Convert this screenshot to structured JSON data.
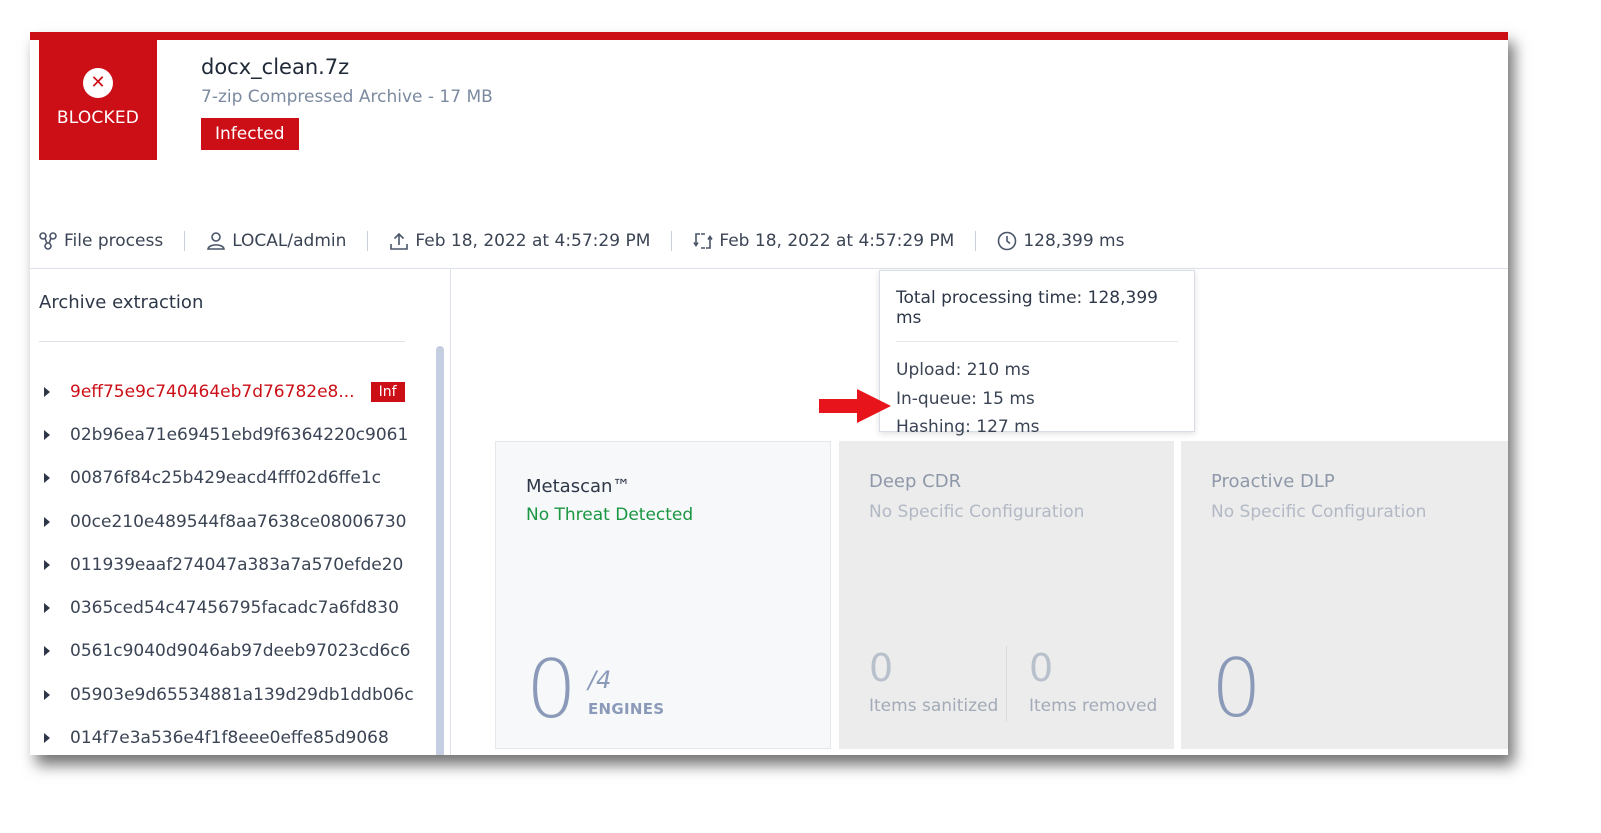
{
  "verdict": {
    "label": "BLOCKED",
    "icon": "close-circle-icon"
  },
  "file": {
    "name": "docx_clean.7z",
    "subtitle": "7-zip Compressed Archive - 17 MB",
    "status_badge": "Infected"
  },
  "meta": {
    "workflow": {
      "icon": "workflow-icon",
      "label": "File process"
    },
    "user": {
      "icon": "user-icon",
      "label": "LOCAL/admin"
    },
    "uploaded": {
      "icon": "upload-icon",
      "label": "Feb 18, 2022 at 4:57:29 PM"
    },
    "processed": {
      "icon": "refresh-icon",
      "label": "Feb 18, 2022 at 4:57:29 PM"
    },
    "duration": {
      "icon": "clock-icon",
      "label": "128,399 ms"
    }
  },
  "tooltip": {
    "title": "Total processing time: 128,399 ms",
    "rows": [
      "Upload: 210 ms",
      "In-queue: 15 ms",
      "Hashing: 127 ms"
    ]
  },
  "sidebar": {
    "title": "Archive extraction",
    "items": [
      {
        "name": "9eff75e9c740464eb7d76782e8...",
        "badge": "Inf",
        "infected": true
      },
      {
        "name": "02b96ea71e69451ebd9f6364220c9061"
      },
      {
        "name": "00876f84c25b429eacd4fff02d6ffe1c"
      },
      {
        "name": "00ce210e489544f8aa7638ce08006730"
      },
      {
        "name": "011939eaaf274047a383a7a570efde20"
      },
      {
        "name": "0365ced54c47456795facadc7a6fd830"
      },
      {
        "name": "0561c9040d9046ab97deeb97023cd6c6"
      },
      {
        "name": "05903e9d65534881a139d29db1ddb06c"
      },
      {
        "name": "014f7e3a536e4f1f8eee0effe85d9068"
      }
    ]
  },
  "cards": {
    "metascan": {
      "title": "Metascan™",
      "status": "No Threat Detected",
      "count": "0",
      "total": "/4",
      "unit": "ENGINES"
    },
    "cdr": {
      "title": "Deep CDR",
      "status": "No Specific Configuration",
      "sanitized_count": "0",
      "sanitized_label": "Items sanitized",
      "removed_count": "0",
      "removed_label": "Items removed"
    },
    "dlp": {
      "title": "Proactive DLP",
      "status": "No Specific Configuration",
      "count": "0"
    }
  },
  "colors": {
    "brand_red": "#cc0f17",
    "ok_green": "#1a9641",
    "annotation_arrow": "#e8141b"
  }
}
